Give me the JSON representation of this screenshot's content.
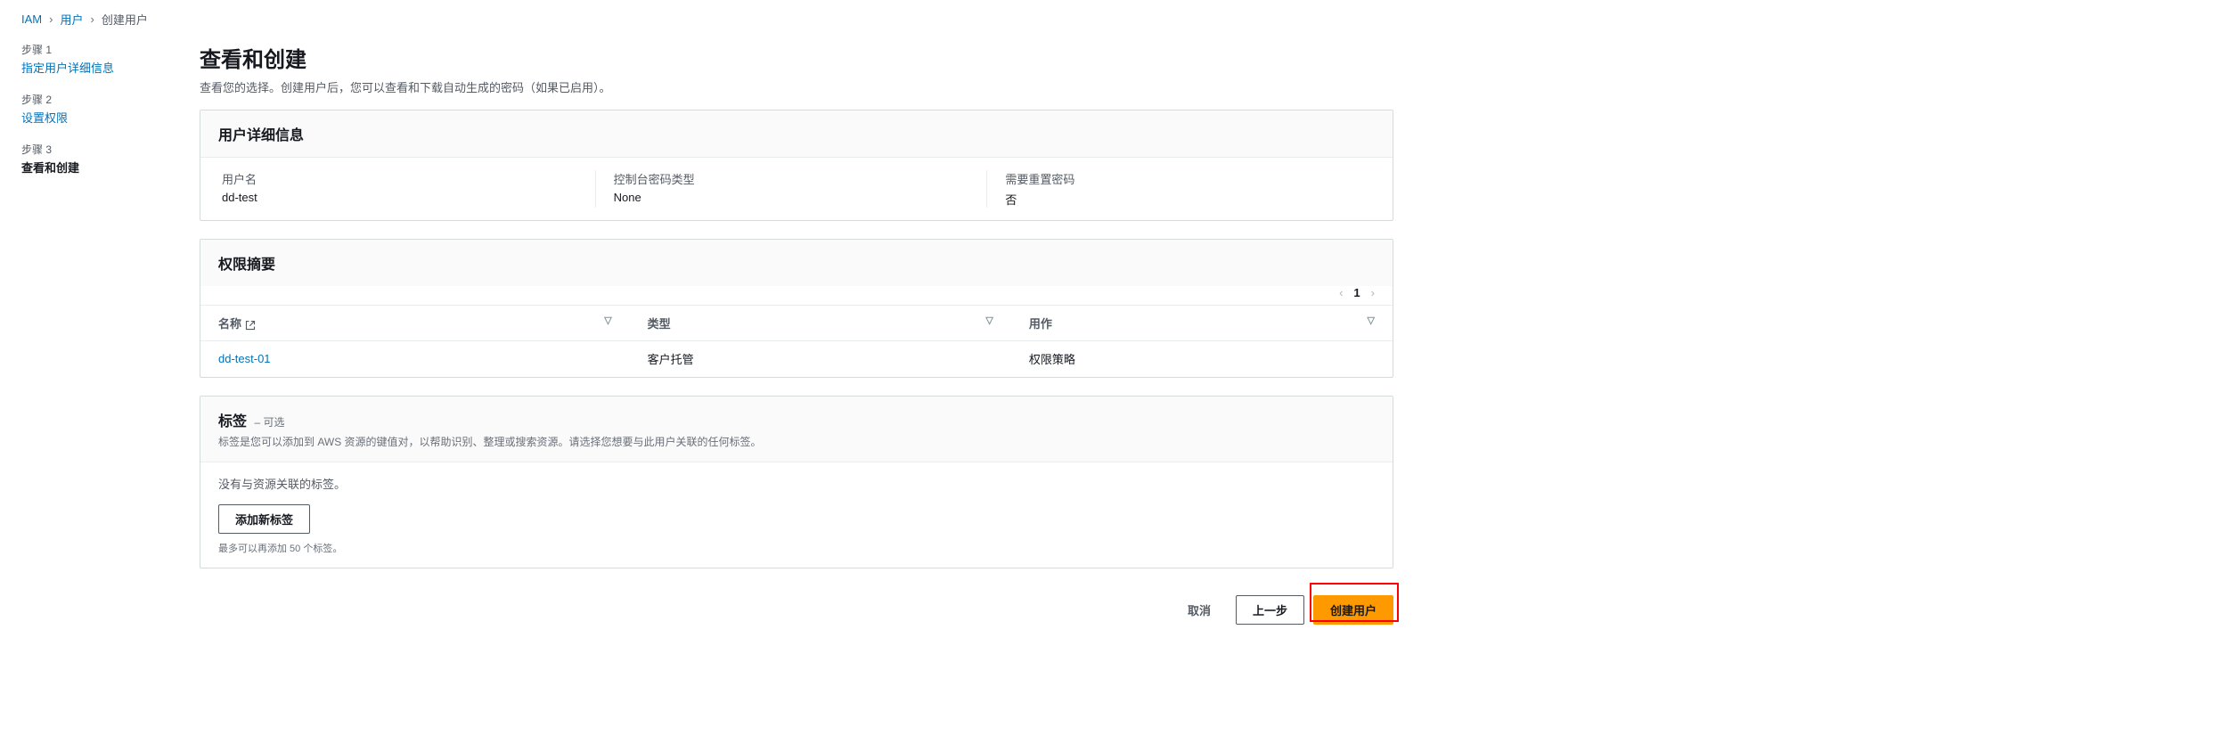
{
  "breadcrumb": {
    "root": "IAM",
    "users": "用户",
    "current": "创建用户"
  },
  "steps": [
    {
      "label": "步骤 1",
      "title": "指定用户详细信息"
    },
    {
      "label": "步骤 2",
      "title": "设置权限"
    },
    {
      "label": "步骤 3",
      "title": "查看和创建"
    }
  ],
  "page": {
    "title": "查看和创建",
    "description": "查看您的选择。创建用户后，您可以查看和下载自动生成的密码（如果已启用）。"
  },
  "userDetails": {
    "panelTitle": "用户详细信息",
    "usernameLabel": "用户名",
    "usernameValue": "dd-test",
    "pwdTypeLabel": "控制台密码类型",
    "pwdTypeValue": "None",
    "resetLabel": "需要重置密码",
    "resetValue": "否"
  },
  "permissions": {
    "panelTitle": "权限摘要",
    "pageNum": "1",
    "columns": {
      "name": "名称",
      "type": "类型",
      "usedAs": "用作"
    },
    "rows": [
      {
        "name": "dd-test-01",
        "type": "客户托管",
        "usedAs": "权限策略"
      }
    ]
  },
  "tags": {
    "panelTitle": "标签",
    "optional": "– 可选",
    "description": "标签是您可以添加到 AWS 资源的键值对，以帮助识别、整理或搜索资源。请选择您想要与此用户关联的任何标签。",
    "emptyText": "没有与资源关联的标签。",
    "addButton": "添加新标签",
    "hint": "最多可以再添加 50 个标签。"
  },
  "footer": {
    "cancel": "取消",
    "previous": "上一步",
    "create": "创建用户"
  }
}
